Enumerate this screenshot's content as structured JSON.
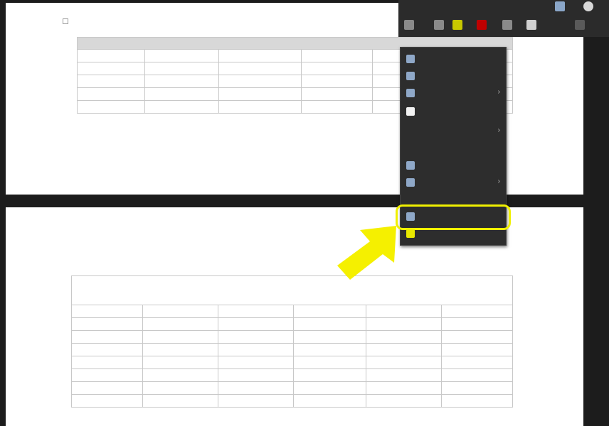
{
  "toolbar": {
    "status_text": "",
    "icon_names": [
      "image-icon",
      "ruler-icon",
      "gear-icon",
      "pin-icon",
      "flag-icon",
      "dots-icon",
      "grid-icon"
    ]
  },
  "slide_top": {
    "table": {
      "title": "",
      "rows": [
        [
          "",
          "",
          "",
          "",
          "",
          ""
        ],
        [
          "",
          "",
          "",
          "",
          "",
          ""
        ],
        [
          "",
          "",
          "",
          "",
          "",
          ""
        ],
        [
          "",
          "",
          "",
          "",
          "",
          ""
        ],
        [
          "",
          "",
          "",
          "",
          "",
          ""
        ]
      ]
    }
  },
  "slide_bottom": {
    "table": {
      "title": "",
      "rows": [
        [
          "",
          "",
          "",
          "",
          "",
          ""
        ],
        [
          "",
          "",
          "",
          "",
          "",
          ""
        ],
        [
          "",
          "",
          "",
          "",
          "",
          ""
        ],
        [
          "",
          "",
          "",
          "",
          "",
          ""
        ],
        [
          "",
          "",
          "",
          "",
          "",
          ""
        ],
        [
          "",
          "",
          "",
          "",
          "",
          ""
        ],
        [
          "",
          "",
          "",
          "",
          "",
          ""
        ],
        [
          "",
          "",
          "",
          "",
          "",
          ""
        ]
      ]
    }
  },
  "context_menu": {
    "items": [
      {
        "label": "",
        "icon": "cut-icon"
      },
      {
        "label": "",
        "icon": "copy-icon"
      },
      {
        "label": "",
        "icon": "paste-icon",
        "submenu": true
      },
      {
        "label": "",
        "icon": "brush-icon"
      },
      {
        "label": "",
        "icon": "",
        "submenu": true
      },
      {
        "label": "",
        "icon": ""
      },
      {
        "label": "",
        "icon": "edit-icon"
      },
      {
        "label": "",
        "icon": "plus-icon",
        "submenu": true
      },
      {
        "label": "",
        "icon": ""
      },
      {
        "label": "",
        "icon": "table-icon"
      },
      {
        "label": "",
        "icon": "check-icon"
      }
    ],
    "highlighted_index": 9
  },
  "annotation": {
    "highlight_color": "#f0f000",
    "arrow_color": "#f5f000"
  }
}
